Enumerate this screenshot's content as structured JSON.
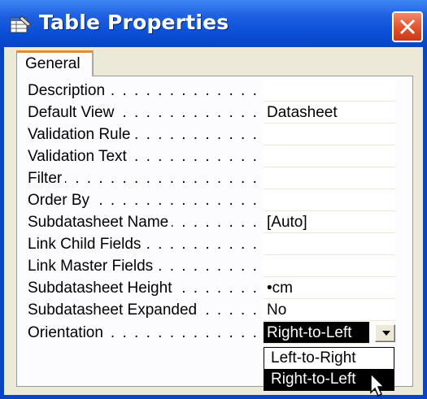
{
  "window": {
    "title": "Table Properties",
    "title_icon": "table-properties-icon",
    "close_icon": "close-icon",
    "close_color": "#e2512c",
    "title_color": "#0a4fd6"
  },
  "tabs": [
    {
      "label": "General",
      "active": true
    }
  ],
  "properties": [
    {
      "label": "Description",
      "value": ""
    },
    {
      "label": "Default View",
      "value": "Datasheet"
    },
    {
      "label": "Validation Rule",
      "value": ""
    },
    {
      "label": "Validation Text",
      "value": ""
    },
    {
      "label": "Filter",
      "value": ""
    },
    {
      "label": "Order By",
      "value": ""
    },
    {
      "label": "Subdatasheet Name",
      "value": "[Auto]"
    },
    {
      "label": "Link Child Fields",
      "value": ""
    },
    {
      "label": "Link Master Fields",
      "value": ""
    },
    {
      "label": "Subdatasheet Height",
      "value": "•cm"
    },
    {
      "label": "Subdatasheet Expanded",
      "value": "No"
    },
    {
      "label": "Orientation",
      "value": "Right-to-Left"
    }
  ],
  "orientation_dropdown": {
    "options": [
      "Left-to-Right",
      "Right-to-Left"
    ],
    "highlighted": "Right-to-Left"
  }
}
